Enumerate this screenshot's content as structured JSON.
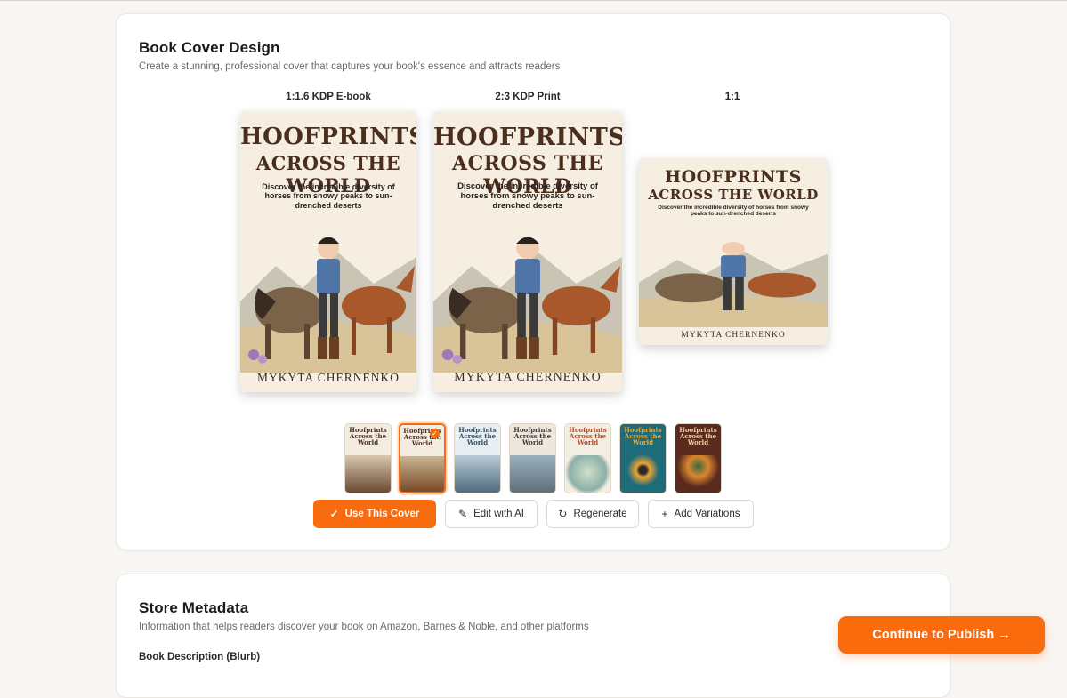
{
  "cover_design": {
    "title": "Book Cover Design",
    "subtitle": "Create a stunning, professional cover that captures your book's essence and attracts readers",
    "formats": [
      {
        "label": "1:1.6 KDP E-book"
      },
      {
        "label": "2:3 KDP Print"
      },
      {
        "label": "1:1"
      }
    ],
    "cover": {
      "title_line1": "HOOFPRINTS",
      "title_line2": "ACROSS THE WORLD",
      "tagline": "Discover the incredible diversity of horses from snowy peaks to sun-drenched deserts",
      "author": "MYKYTA CHERNENKO"
    },
    "thumbnails": [
      {
        "title": "Hoofprints Across the World",
        "colors": [
          "#efe6d6",
          "#6b4a33"
        ],
        "selected": false
      },
      {
        "title": "Hoofprints Across the World",
        "colors": [
          "#f6efe3",
          "#7a4a2a"
        ],
        "selected": true
      },
      {
        "title": "Hoofprints Across the World",
        "colors": [
          "#e7eef2",
          "#4f6b7e"
        ],
        "selected": false
      },
      {
        "title": "Hoofprints Across the World",
        "colors": [
          "#efe7db",
          "#5e6f7a"
        ],
        "selected": false
      },
      {
        "title": "Hoofprints Across the World",
        "colors": [
          "#f4ede2",
          "#8cb0a8"
        ],
        "selected": false
      },
      {
        "title": "Hoofprints Across the World",
        "colors": [
          "#1e6b7a",
          "#f0a431"
        ],
        "selected": false
      },
      {
        "title": "Hoofprints Across the World",
        "colors": [
          "#5a2a1e",
          "#d9862e"
        ],
        "selected": false
      }
    ],
    "actions": {
      "use": "Use This Cover",
      "edit": "Edit with AI",
      "regenerate": "Regenerate",
      "variations": "Add Variations"
    },
    "icons": {
      "use": "check-icon",
      "edit": "pencil-icon",
      "regenerate": "refresh-icon",
      "variations": "plus-icon"
    }
  },
  "store_metadata": {
    "title": "Store Metadata",
    "subtitle": "Information that helps readers discover your book on Amazon, Barnes & Noble, and other platforms",
    "description_label": "Book Description (Blurb)"
  },
  "continue_button": "Continue to Publish →",
  "colors": {
    "accent": "#f96b0f",
    "page_bg": "#f8f6f2",
    "card_bg": "#ffffff"
  }
}
